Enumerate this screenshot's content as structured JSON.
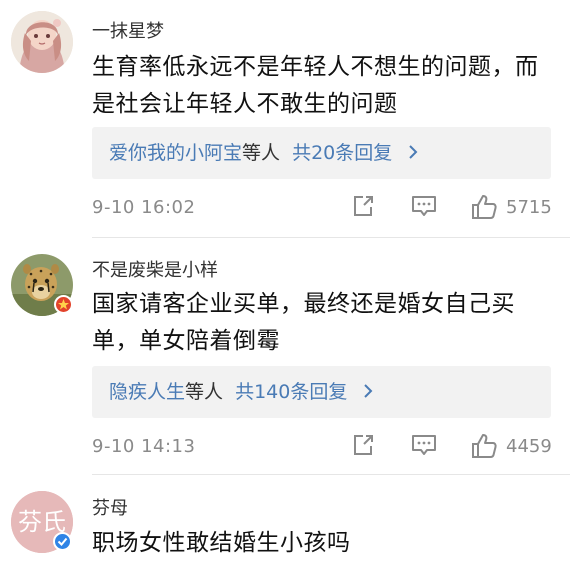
{
  "comments": [
    {
      "username": "一抹星梦",
      "text_line1": "生育率低永远不是年轻人不想生的问题，而",
      "text_line2": "是社会让年轻人不敢生的问题",
      "reply_names": "爱你我的小阿宝",
      "reply_suffix": "等人",
      "reply_count": "共20条回复",
      "timestamp": "9-10 16:02",
      "likes": "5715",
      "avatar_icon": "anime-character-avatar",
      "badge": null
    },
    {
      "username": "不是废柴是小样",
      "text_line1": "国家请客企业买单，最终还是婚女自己买",
      "text_line2": "单，单女陪着倒霉",
      "reply_names": "隐疾人生",
      "reply_suffix": "等人",
      "reply_count": "共140条回复",
      "timestamp": "9-10 14:13",
      "likes": "4459",
      "avatar_icon": "cheetah-avatar",
      "badge": "red-star-badge"
    },
    {
      "username": "芬母",
      "avatar_text": "芬氏",
      "text_line1": "职场女性敢结婚生小孩吗",
      "avatar_icon": "text-avatar",
      "badge": "verified-badge"
    }
  ],
  "colors": {
    "link_blue": "#4a7bb5",
    "meta_gray": "#8a8a8a",
    "reply_bg": "#f2f2f2",
    "avatar_pink": "#e6b9b9",
    "badge_red": "#e2432b",
    "badge_blue": "#2f84e6"
  }
}
